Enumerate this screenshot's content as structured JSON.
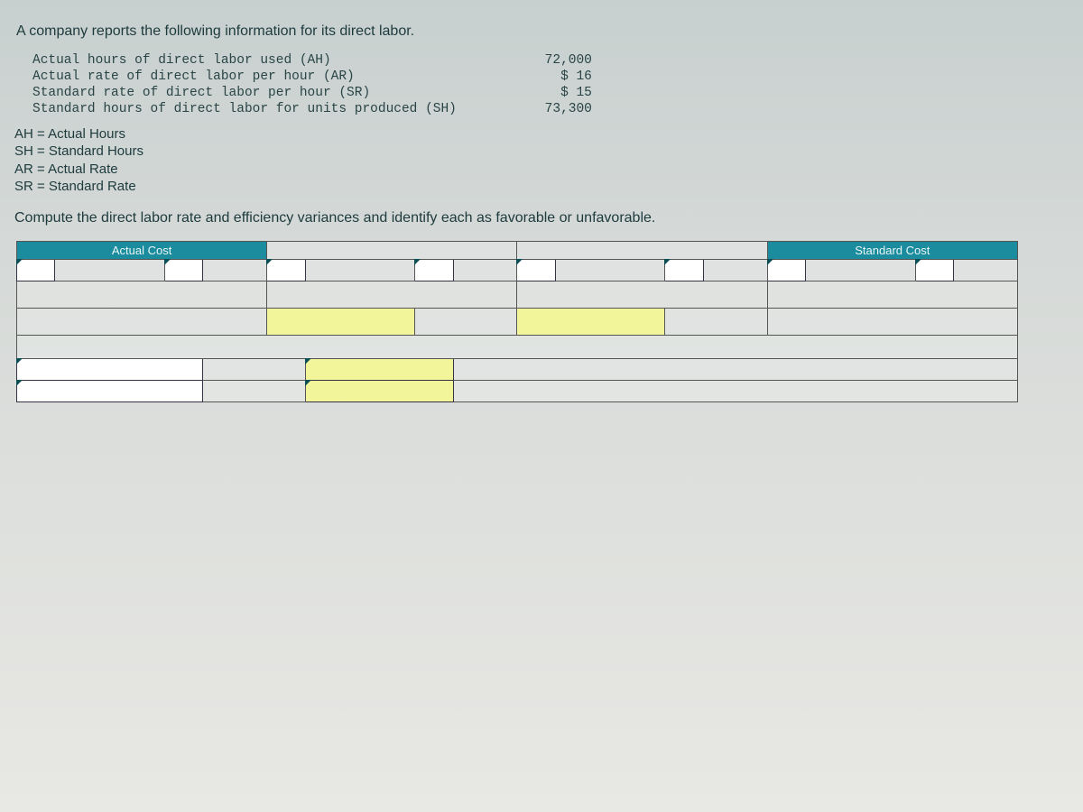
{
  "intro": "A company reports the following information for its direct labor.",
  "data": {
    "labels": {
      "l1": "Actual hours of direct labor used (AH)",
      "l2": "Actual rate of direct labor per hour (AR)",
      "l3": "Standard rate of direct labor per hour (SR)",
      "l4": "Standard hours of direct labor for units produced (SH)"
    },
    "values": {
      "v1": "72,000",
      "v2": "$ 16",
      "v3": "$ 15",
      "v4": "73,300"
    }
  },
  "legend": {
    "l1": "AH = Actual Hours",
    "l2": "SH = Standard Hours",
    "l3": "AR = Actual Rate",
    "l4": "SR = Standard Rate"
  },
  "prompt": "Compute the direct labor rate and efficiency variances and identify each as favorable or unfavorable.",
  "headers": {
    "actual_cost": "Actual Cost",
    "standard_cost": "Standard Cost"
  }
}
